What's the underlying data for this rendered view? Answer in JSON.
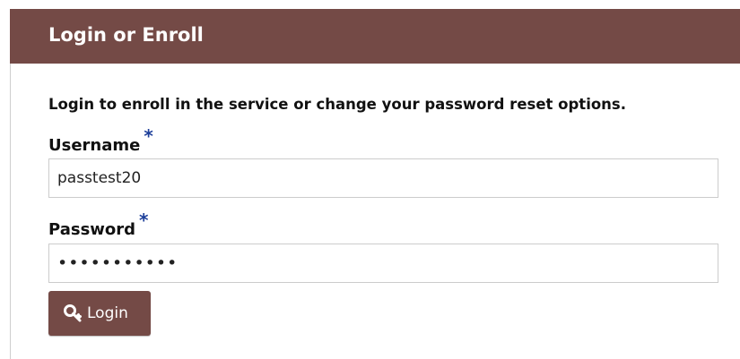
{
  "panel": {
    "title": "Login or Enroll",
    "header_color": "#744a46"
  },
  "intro_text": "Login to enroll in the service or change your password reset options.",
  "form": {
    "username": {
      "label": "Username",
      "required_marker": "*",
      "value": "passtest20"
    },
    "password": {
      "label": "Password",
      "required_marker": "*",
      "value": "***********"
    },
    "login_button": {
      "label": "Login",
      "icon": "key-icon"
    }
  },
  "colors": {
    "accent": "#744a46",
    "required_marker": "#1d3f9a"
  }
}
